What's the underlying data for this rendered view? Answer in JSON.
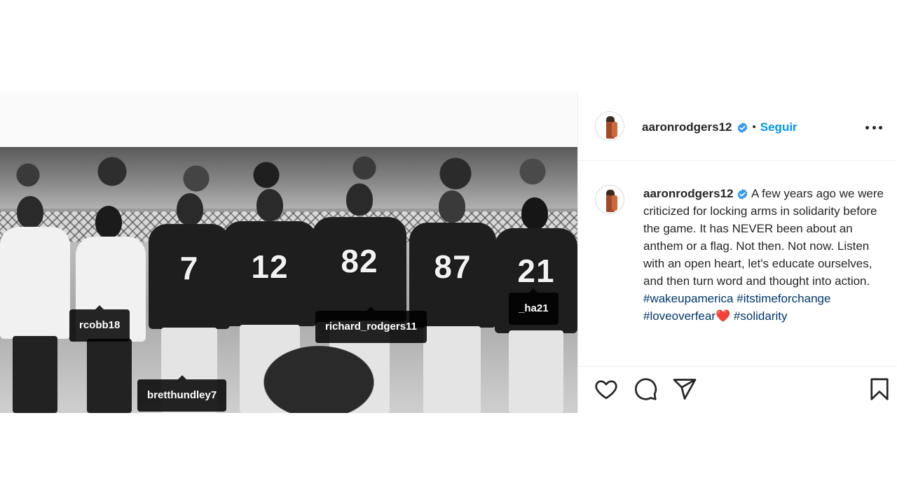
{
  "tags": {
    "rcobb": "rcobb18",
    "brett": "bretthundley7",
    "richard": "richard_rodgers11",
    "ha": "_ha21"
  },
  "photo": {
    "jersey_numbers": [
      "7",
      "12",
      "82",
      "87",
      "21"
    ]
  },
  "post_header": {
    "username": "aaronrodgers12",
    "separator": "•",
    "follow_label": "Seguir"
  },
  "caption": {
    "username": "aaronrodgers12",
    "text": " A few years ago we were criticized for locking arms in solidarity before the game. It has NEVER been about an anthem or a flag. Not then. Not now. Listen with an open heart, let's educate ourselves, and then turn word and thought into action. ",
    "hashtags": [
      "#wakeupamerica",
      "#itstimeforchange",
      "#loveoverfear",
      "#solidarity"
    ],
    "emoji": "❤️"
  },
  "icons": {
    "like": "heart-icon",
    "comment": "comment-icon",
    "share": "share-icon",
    "save": "bookmark-icon",
    "verified": "verified-badge-icon",
    "more": "more-options-icon"
  },
  "colors": {
    "link_blue": "#0095f6",
    "hashtag": "#00376b",
    "verified": "#3897f0",
    "text": "#262626",
    "tag_bg": "#000000"
  }
}
